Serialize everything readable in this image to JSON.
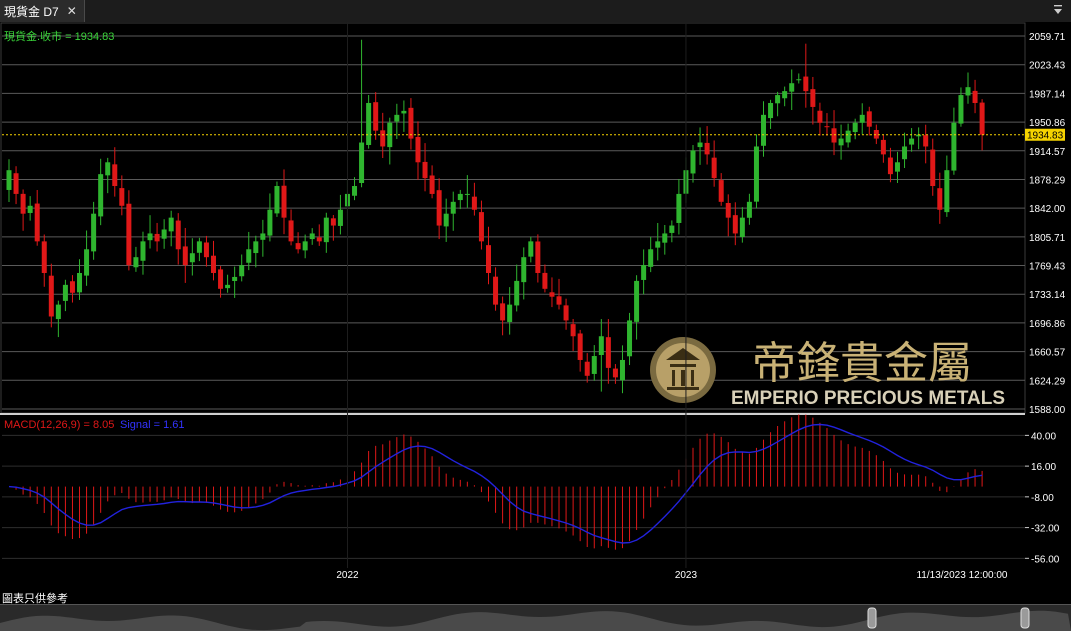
{
  "window": {
    "tab_label": "現貨金 D7",
    "close_glyph": "✕",
    "menu_icon": "menu-icon"
  },
  "price_panel": {
    "legend": "現貨金.收市 = 1934.83",
    "last_price_label": "1934.83",
    "watermark_cn": "帝鋒貴金屬",
    "watermark_en": "EMPERIO PRECIOUS METALS"
  },
  "macd_panel": {
    "legend_macd": "MACD(12,26,9) = 8.05",
    "legend_signal": "Signal = 1.61"
  },
  "footer": {
    "note": "圖表只供參考"
  },
  "colors": {
    "up": "#2fb52f",
    "down": "#e01818",
    "grid": "#5a5a5a",
    "last_price": "#f5d300",
    "signal": "#2222dd",
    "macd": "#e01818",
    "legend_green": "#3ad43a"
  },
  "chart_data": [
    {
      "type": "candlestick",
      "yticks": [
        1588.0,
        1624.29,
        1660.57,
        1696.86,
        1733.14,
        1769.43,
        1805.71,
        1842.0,
        1878.29,
        1914.57,
        1950.86,
        1987.14,
        2023.43,
        2059.71
      ],
      "ylim": [
        1588.0,
        2059.71
      ],
      "last_price": 1934.83,
      "xtick_labels": [
        "2022",
        "2023",
        "11/13/2023 12:00:00"
      ],
      "xtick_positions": [
        48,
        96
      ],
      "num_bars": 137,
      "close_path": [
        1890,
        1860,
        1835,
        1845,
        1800,
        1760,
        1705,
        1720,
        1745,
        1735,
        1760,
        1790,
        1835,
        1885,
        1900,
        1870,
        1845,
        1770,
        1780,
        1800,
        1810,
        1800,
        1815,
        1830,
        1790,
        1770,
        1785,
        1800,
        1780,
        1760,
        1740,
        1745,
        1755,
        1770,
        1790,
        1800,
        1810,
        1840,
        1870,
        1830,
        1800,
        1790,
        1800,
        1810,
        1800,
        1830,
        1820,
        1840,
        1860,
        1870,
        1925,
        1975,
        1940,
        1920,
        1950,
        1960,
        1965,
        1930,
        1900,
        1880,
        1860,
        1820,
        1835,
        1850,
        1860,
        1860,
        1840,
        1800,
        1760,
        1720,
        1700,
        1720,
        1750,
        1780,
        1800,
        1760,
        1740,
        1730,
        1720,
        1700,
        1680,
        1650,
        1630,
        1655,
        1680,
        1640,
        1628,
        1650,
        1700,
        1750,
        1770,
        1790,
        1800,
        1810,
        1820,
        1860,
        1890,
        1915,
        1925,
        1910,
        1880,
        1850,
        1830,
        1810,
        1830,
        1850,
        1920,
        1960,
        1975,
        1985,
        1990,
        2000,
        2005,
        1990,
        1970,
        1950,
        1945,
        1925,
        1930,
        1940,
        1950,
        1960,
        1945,
        1930,
        1910,
        1885,
        1900,
        1920,
        1930,
        1935,
        1920,
        1870,
        1840,
        1890,
        1950,
        1985,
        1995,
        1975,
        1934.83
      ]
    },
    {
      "type": "macd",
      "yticks": [
        40.0,
        16.0,
        -8.0,
        -32.0,
        -56.0
      ],
      "ylim": [
        -62,
        52
      ],
      "macd_last": 8.05,
      "signal_last": 1.61
    }
  ]
}
